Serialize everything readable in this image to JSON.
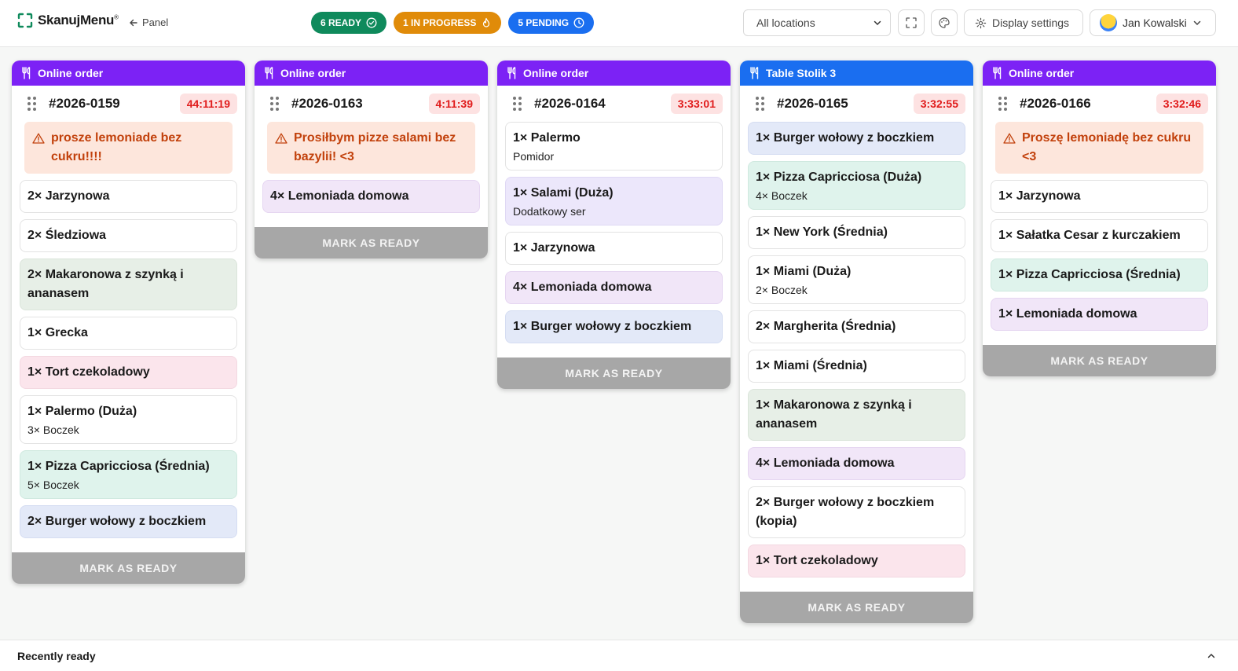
{
  "app": {
    "brand": "SkanujMenu",
    "brand_mark": "®",
    "back_label": "Panel"
  },
  "status": {
    "ready": "6 READY",
    "in_progress": "1 IN PROGRESS",
    "pending": "5 PENDING"
  },
  "controls": {
    "location_select": "All locations",
    "display_settings": "Display settings",
    "user_name": "Jan Kowalski"
  },
  "colors": {
    "online": "#7c22f5",
    "table": "#1a6ef0",
    "ready": "#0f8a5c",
    "progress": "#e08b09",
    "pending": "#1a6ef0"
  },
  "orders": [
    {
      "type": "online",
      "header": "Online order",
      "number": "#2026-0159",
      "timer": "44:11:19",
      "note": "prosze lemoniade bez cukru!!!!",
      "items": [
        {
          "name": "2× Jarzynowa",
          "tone": "plain"
        },
        {
          "name": "2× Śledziowa",
          "tone": "plain"
        },
        {
          "name": "2× Makaronowa z szynką i ananasem",
          "tone": "green"
        },
        {
          "name": "1× Grecka",
          "tone": "plain"
        },
        {
          "name": "1× Tort czekoladowy",
          "tone": "pink"
        },
        {
          "name": "1× Palermo (Duża)",
          "mod": "3× Boczek",
          "tone": "plain"
        },
        {
          "name": "1× Pizza Capricciosa (Średnia)",
          "mod": "5× Boczek",
          "tone": "mint"
        },
        {
          "name": "2× Burger wołowy z boczkiem",
          "tone": "blue"
        }
      ],
      "action": "MARK AS READY"
    },
    {
      "type": "online",
      "header": "Online order",
      "number": "#2026-0163",
      "timer": "4:11:39",
      "note": "Prosiłbym pizze salami bez bazylii! <3",
      "items": [
        {
          "name": "4× Lemoniada domowa",
          "tone": "lilac"
        }
      ],
      "action": "MARK AS READY"
    },
    {
      "type": "online",
      "header": "Online order",
      "number": "#2026-0164",
      "timer": "3:33:01",
      "note": "",
      "items": [
        {
          "name": "1× Palermo",
          "mod": "Pomidor",
          "tone": "plain"
        },
        {
          "name": "1× Salami (Duża)",
          "mod": "Dodatkowy ser",
          "tone": "lav"
        },
        {
          "name": "1× Jarzynowa",
          "tone": "plain"
        },
        {
          "name": "4× Lemoniada domowa",
          "tone": "lilac"
        },
        {
          "name": "1× Burger wołowy z boczkiem",
          "tone": "blue"
        }
      ],
      "action": "MARK AS READY"
    },
    {
      "type": "table",
      "header": "Table Stolik 3",
      "number": "#2026-0165",
      "timer": "3:32:55",
      "note": "",
      "items": [
        {
          "name": "1× Burger wołowy z boczkiem",
          "tone": "blue"
        },
        {
          "name": "1× Pizza Capricciosa (Duża)",
          "mod": "4× Boczek",
          "tone": "mint"
        },
        {
          "name": "1× New York (Średnia)",
          "tone": "plain"
        },
        {
          "name": "1× Miami (Duża)",
          "mod": "2× Boczek",
          "tone": "plain"
        },
        {
          "name": "2× Margherita (Średnia)",
          "tone": "plain"
        },
        {
          "name": "1× Miami (Średnia)",
          "tone": "plain"
        },
        {
          "name": "1× Makaronowa z szynką i ananasem",
          "tone": "green"
        },
        {
          "name": "4× Lemoniada domowa",
          "tone": "lilac"
        },
        {
          "name": "2× Burger wołowy z boczkiem (kopia)",
          "tone": "plain"
        },
        {
          "name": "1× Tort czekoladowy",
          "tone": "pink"
        }
      ],
      "action": "MARK AS READY"
    },
    {
      "type": "online",
      "header": "Online order",
      "number": "#2026-0166",
      "timer": "3:32:46",
      "note": "Proszę lemoniadę bez cukru <3",
      "items": [
        {
          "name": "1× Jarzynowa",
          "tone": "plain"
        },
        {
          "name": "1× Sałatka Cesar z kurczakiem",
          "tone": "plain"
        },
        {
          "name": "1× Pizza Capricciosa (Średnia)",
          "tone": "mint"
        },
        {
          "name": "1× Lemoniada domowa",
          "tone": "lilac"
        }
      ],
      "action": "MARK AS READY"
    }
  ],
  "footer": {
    "title": "Recently ready"
  }
}
